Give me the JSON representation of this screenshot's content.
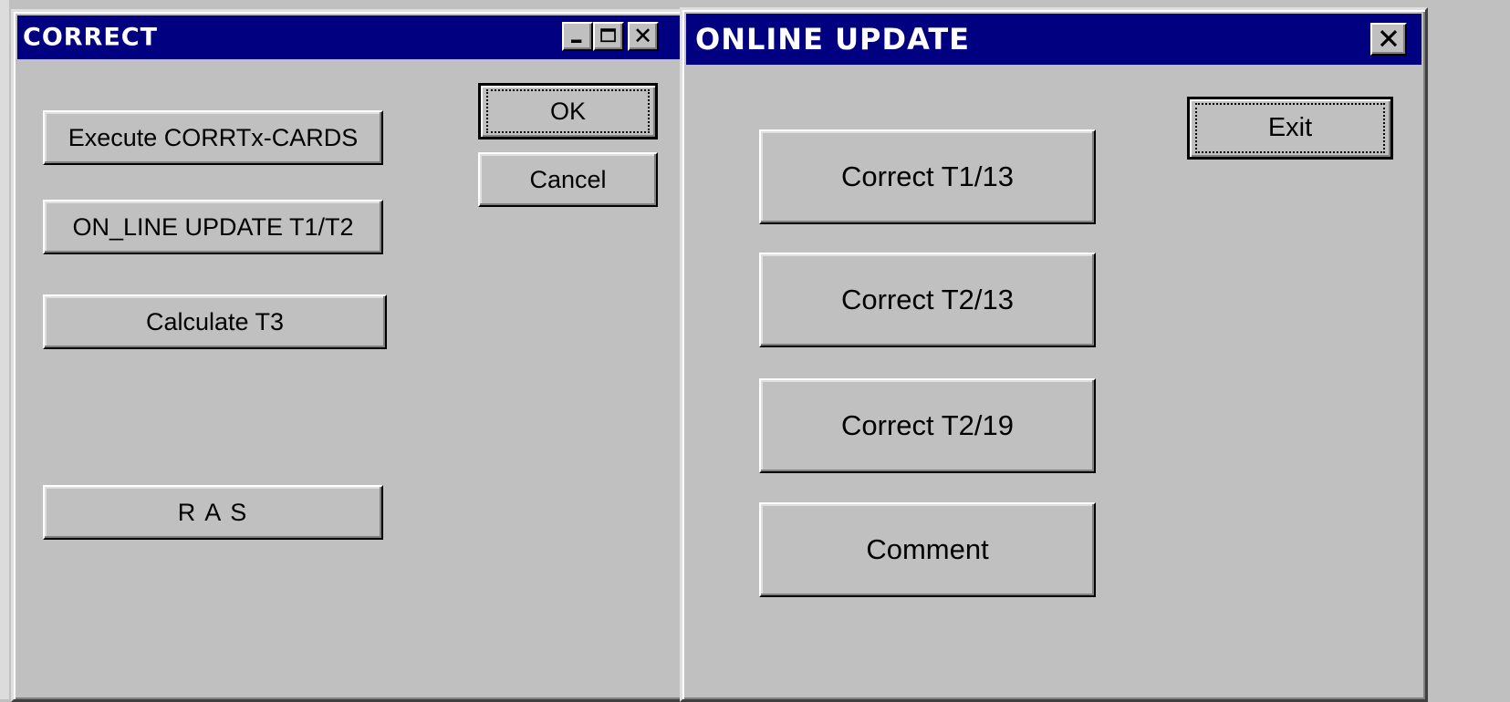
{
  "correct_dialog": {
    "title": "CORRECT",
    "buttons": {
      "execute_cards": "Execute CORRTx-CARDS",
      "online_update": "ON_LINE UPDATE T1/T2",
      "calculate_t3": "Calculate T3",
      "ras": "R A S",
      "ok": "OK",
      "cancel": "Cancel"
    }
  },
  "online_update_dialog": {
    "title": "ONLINE UPDATE",
    "buttons": {
      "correct_t1_13": "Correct T1/13",
      "correct_t2_13": "Correct T2/13",
      "correct_t2_19": "Correct T2/19",
      "comment": "Comment",
      "exit": "Exit"
    }
  },
  "colors": {
    "title_bar": "#000080",
    "face": "#c0c0c0"
  },
  "icons": [
    "minimize-icon",
    "maximize-icon",
    "close-icon"
  ]
}
